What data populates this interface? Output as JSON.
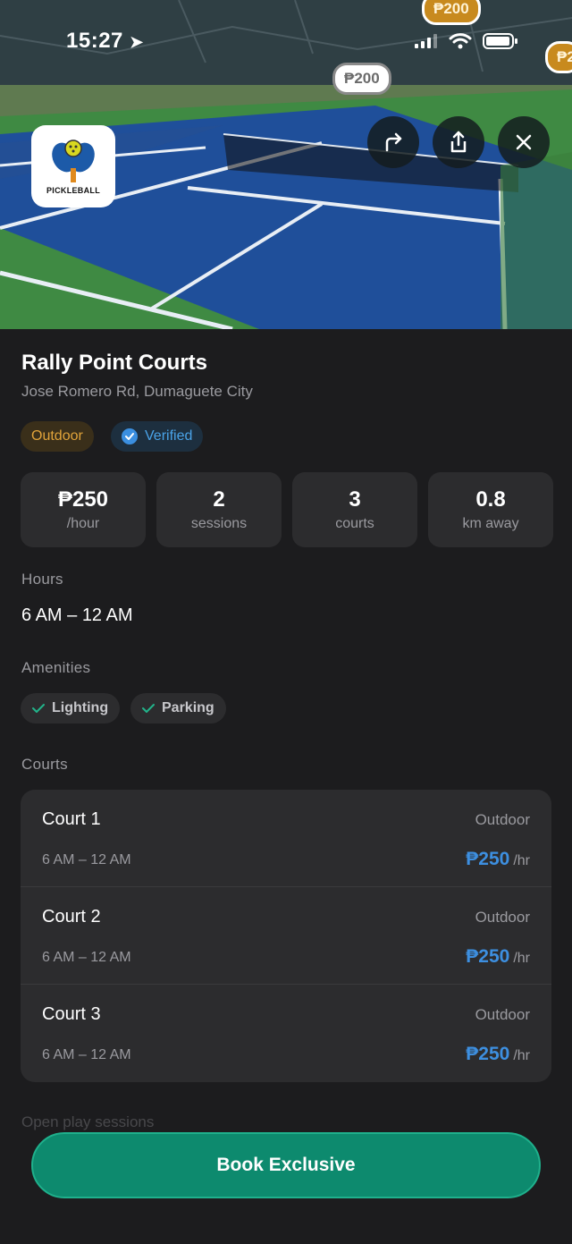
{
  "status_bar": {
    "time": "15:27"
  },
  "map_pins": [
    "₱200",
    "₱200",
    "₱2"
  ],
  "logo": {
    "text": "PICKLEBALL"
  },
  "hero_actions": [
    "directions-icon",
    "share-icon",
    "close-icon"
  ],
  "venue": {
    "name": "Rally Point Courts",
    "address": "Jose Romero Rd, Dumaguete City",
    "badges": {
      "outdoor": "Outdoor",
      "verified": "Verified"
    }
  },
  "stats": [
    {
      "value": "₱250",
      "label": "/hour"
    },
    {
      "value": "2",
      "label": "sessions"
    },
    {
      "value": "3",
      "label": "courts"
    },
    {
      "value": "0.8",
      "label": "km away"
    }
  ],
  "hours": {
    "label": "Hours",
    "value": "6 AM – 12 AM"
  },
  "amenities": {
    "label": "Amenities",
    "items": [
      "Lighting",
      "Parking"
    ]
  },
  "courts": {
    "label": "Courts",
    "items": [
      {
        "name": "Court 1",
        "type": "Outdoor",
        "hours": "6 AM – 12 AM",
        "price": "₱250",
        "unit": "/hr"
      },
      {
        "name": "Court 2",
        "type": "Outdoor",
        "hours": "6 AM – 12 AM",
        "price": "₱250",
        "unit": "/hr"
      },
      {
        "name": "Court 3",
        "type": "Outdoor",
        "hours": "6 AM – 12 AM",
        "price": "₱250",
        "unit": "/hr"
      }
    ]
  },
  "open_play": {
    "label": "Open play sessions"
  },
  "cta": {
    "label": "Book Exclusive"
  },
  "colors": {
    "accent": "#0d8a6e",
    "price_blue": "#3d8fe0",
    "outdoor": "#e0a33a",
    "verified": "#4aa3e8"
  }
}
